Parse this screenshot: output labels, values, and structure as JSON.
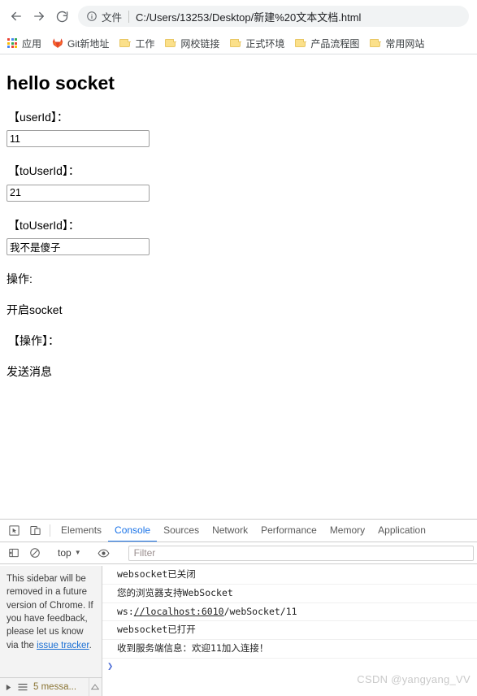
{
  "browser": {
    "nav": {
      "back_label": "Back",
      "forward_label": "Forward",
      "reload_label": "Reload"
    },
    "omnibox": {
      "info_icon": "info-circle-icon",
      "scheme_label": "文件",
      "url": "C:/Users/13253/Desktop/新建%20文本文档.html"
    },
    "bookmarks": [
      {
        "icon": "apps-grid-icon",
        "label": "应用"
      },
      {
        "icon": "gitlab-fox-icon",
        "label": "Git新地址"
      },
      {
        "icon": "folder-icon",
        "label": "工作"
      },
      {
        "icon": "folder-icon",
        "label": "网校链接"
      },
      {
        "icon": "folder-icon",
        "label": "正式环境"
      },
      {
        "icon": "folder-icon",
        "label": "产品流程图"
      },
      {
        "icon": "folder-icon",
        "label": "常用网站"
      }
    ]
  },
  "page": {
    "heading": "hello socket",
    "labels": {
      "user_id": "【userId】：",
      "to_user_id": "【toUserId】：",
      "message": "【toUserId】：",
      "operations": "操作:",
      "operations_bracket": "【操作】："
    },
    "inputs": {
      "user_id_value": "11",
      "to_user_id_value": "21",
      "message_value": "我不是傻子"
    },
    "actions": {
      "open_socket": "开启socket",
      "send_message": "发送消息"
    }
  },
  "devtools": {
    "toolbar_icons": {
      "inspect": "inspect-element-icon",
      "device": "device-toolbar-icon"
    },
    "tabs": [
      {
        "label": "Elements",
        "active": false
      },
      {
        "label": "Console",
        "active": true
      },
      {
        "label": "Sources",
        "active": false
      },
      {
        "label": "Network",
        "active": false
      },
      {
        "label": "Performance",
        "active": false
      },
      {
        "label": "Memory",
        "active": false
      },
      {
        "label": "Application",
        "active": false
      }
    ],
    "filterbar": {
      "sidebar_toggle_icon": "show-console-sidebar-icon",
      "clear_icon": "clear-console-icon",
      "context_value": "top",
      "eye_icon": "live-expression-icon",
      "filter_placeholder": "Filter",
      "filter_value": ""
    },
    "sidebar": {
      "notice_part1": "This sidebar will be removed in a future version of Chrome. If you have feedback, please let us know via the ",
      "notice_link": "issue tracker",
      "notice_part2": "."
    },
    "console_rows": [
      {
        "text": "websocket已关闭",
        "link": ""
      },
      {
        "text": "您的浏览器支持WebSocket",
        "link": ""
      },
      {
        "prefix": "ws:",
        "link": "//localhost:6010",
        "suffix": "/webSocket/11"
      },
      {
        "text": "websocket已打开",
        "link": ""
      },
      {
        "text": "收到服务端信息：欢迎11加入连接！",
        "link": ""
      }
    ],
    "prompt_symbol": "❯",
    "statusbar": {
      "expand_icon": "triangle-right-icon",
      "list_icon": "list-icon",
      "message_count": "5 messa...",
      "scroll_icon": "scroll-up-icon"
    }
  },
  "watermark": "CSDN @yangyang_VV",
  "colors": {
    "accent": "#1a73e8",
    "omnibox_bg": "#f1f3f4",
    "folder": "#fbe08a",
    "devtools_border": "#cdcdcd"
  }
}
